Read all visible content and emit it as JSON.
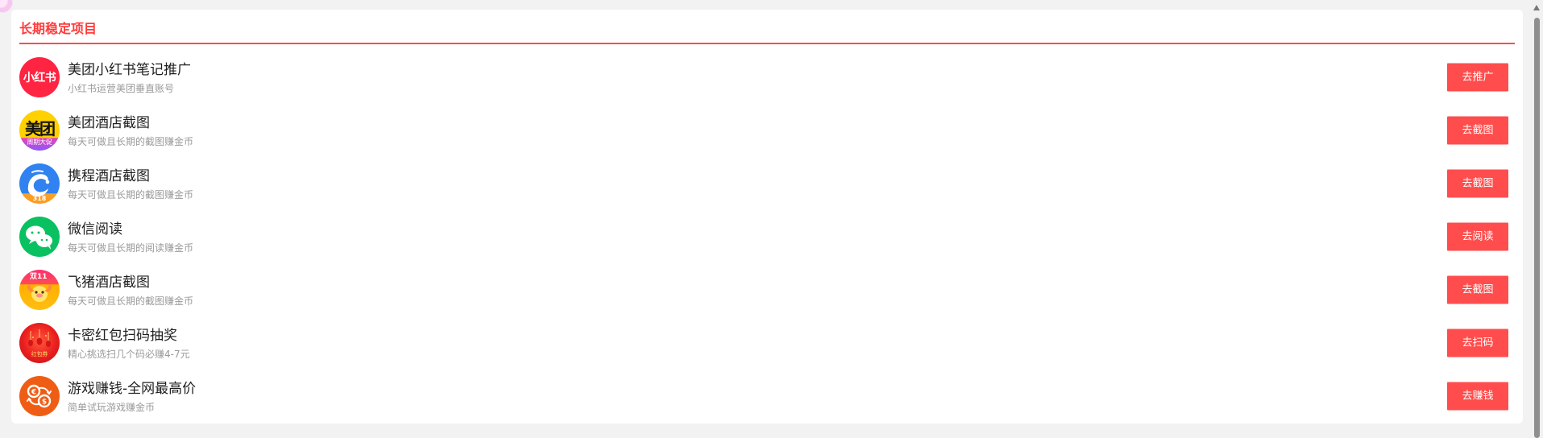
{
  "section": {
    "title": "长期稳定项目"
  },
  "items": [
    {
      "title": "美团小红书笔记推广",
      "desc": "小红书运营美团垂直账号",
      "button": "去推广",
      "logo_text": "小红书",
      "logo_icon": "xiaohongshu-logo-icon"
    },
    {
      "title": "美团酒店截图",
      "desc": "每天可做且长期的截图赚金币",
      "button": "去截图",
      "logo_text": "美团",
      "logo_subtext": "周期大促",
      "logo_icon": "meituan-logo-icon"
    },
    {
      "title": "携程酒店截图",
      "desc": "每天可做且长期的截图赚金币",
      "button": "去截图",
      "logo_badge": "318",
      "logo_icon": "ctrip-logo-icon"
    },
    {
      "title": "微信阅读",
      "desc": "每天可做且长期的阅读赚金币",
      "button": "去阅读",
      "logo_icon": "wechat-logo-icon"
    },
    {
      "title": "飞猪酒店截图",
      "desc": "每天可做且长期的截图赚金币",
      "button": "去截图",
      "logo_text": "双11",
      "logo_icon": "fliggy-logo-icon"
    },
    {
      "title": "卡密红包扫码抽奖",
      "desc": "精心挑选扫几个码必赚4-7元",
      "button": "去扫码",
      "logo_text": "红包券",
      "logo_icon": "red-packet-logo-icon"
    },
    {
      "title": "游戏赚钱-全网最高价",
      "desc": "简单试玩游戏赚金币",
      "button": "去赚钱",
      "logo_icon": "money-exchange-logo-icon"
    }
  ],
  "colors": {
    "accent": "#ff4d4d",
    "title": "#ff3b3b",
    "background": "#f2f2f2",
    "card": "#ffffff"
  }
}
